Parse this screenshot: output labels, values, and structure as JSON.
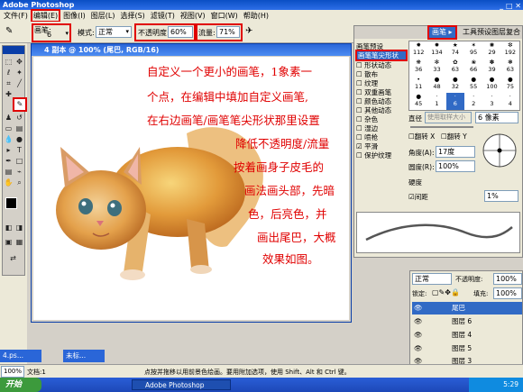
{
  "app": {
    "title": "Adobe Photoshop"
  },
  "menu": [
    "文件(F)",
    "编辑(E)",
    "图像(I)",
    "图层(L)",
    "选择(S)",
    "滤镜(T)",
    "视图(V)",
    "窗口(W)",
    "帮助(H)"
  ],
  "options": {
    "brush_label": "画笔:",
    "brush_size": "6",
    "mode_label": "模式:",
    "mode_value": "正常",
    "opacity_label": "不透明度:",
    "opacity_value": "60%",
    "flow_label": "流量:",
    "flow_value": "71%"
  },
  "document": {
    "title": "4 副本 @ 100% (尾巴, RGB/16)"
  },
  "annotation": {
    "lines": [
      "自定义一个更小的画笔，1象素一",
      "个点，在编辑中填加自定义画笔,",
      "在右边画笔/画笔笔尖形状那里设置",
      "降低不透明度/流量",
      "按着画身子皮毛的",
      "画法画头部，先暗",
      "色，后亮色，并",
      "画出尾巴，大概",
      "效果如图。"
    ]
  },
  "brush_panel": {
    "tabs": [
      "画笔",
      "工具预设",
      "图层复合"
    ],
    "list": [
      "画笔预设",
      "画笔笔尖形状",
      "形状动态",
      "散布",
      "纹理",
      "双重画笔",
      "颜色动态",
      "其他动态",
      "杂色",
      "湿边",
      "喷枪",
      "平滑",
      "保护纹理"
    ],
    "checked": [
      false,
      false,
      false,
      false,
      false,
      false,
      false,
      false,
      false,
      false,
      false,
      true,
      false
    ],
    "preset_sizes": [
      "112",
      "134",
      "74",
      "95",
      "29",
      "192",
      "36",
      "33",
      "63",
      "66",
      "39",
      "63",
      "11",
      "48",
      "32",
      "55",
      "100",
      "75",
      "45",
      "1",
      "6",
      "2",
      "3",
      "4"
    ],
    "diameter_label": "直径",
    "use_sample_label": "使用取样大小",
    "diameter_value": "6 像素",
    "flip_x": "翻转 X",
    "flip_y": "翻转 Y",
    "angle_label": "角度(A):",
    "angle_value": "17度",
    "roundness_label": "圆度(R):",
    "roundness_value": "100%",
    "hardness_label": "硬度",
    "spacing_label": "间距",
    "spacing_value": "1%"
  },
  "layers_panel": {
    "mode": "正常",
    "opacity_label": "不透明度:",
    "opacity_value": "100%",
    "lock_label": "锁定:",
    "fill_label": "填充:",
    "fill_value": "100%",
    "layers": [
      "尾巴",
      "图层 6",
      "图层 4",
      "图层 5",
      "图层 3"
    ]
  },
  "status": {
    "zoom": "100%",
    "doc_label": "文档:1",
    "hint": "点按并拖移以用前景色绘画。要用附加选项，使用 Shift、Alt 和 Ctrl 键。"
  },
  "docked_tabs": [
    "4.ps...",
    "未标..."
  ],
  "taskbar": {
    "start": "开始",
    "app": "Adobe Photoshop",
    "time": "5:29"
  },
  "colors": {
    "annotation": "#e00000",
    "highlight": "#e00000",
    "xp_blue": "#1d48b8",
    "selected_row": "#316ac5"
  }
}
